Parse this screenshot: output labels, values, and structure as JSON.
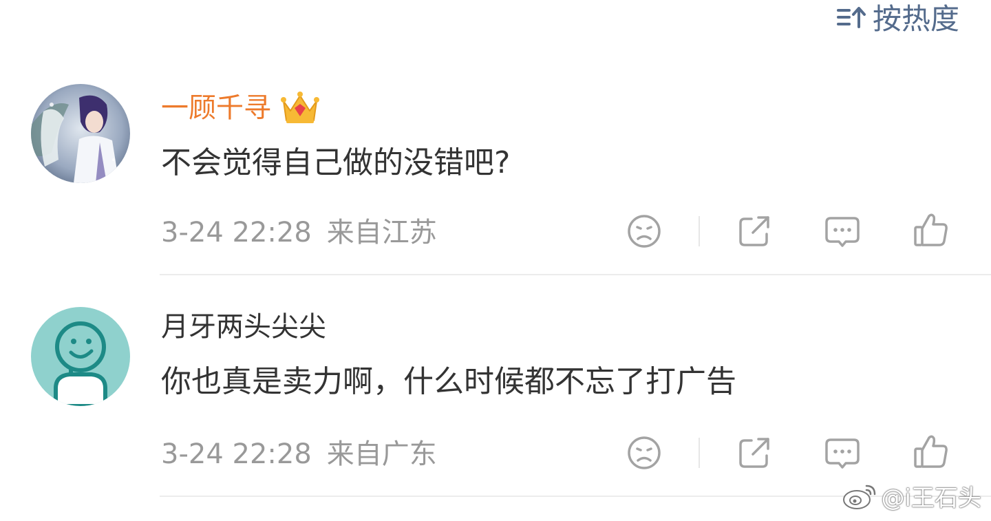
{
  "header": {
    "sort_label": "按热度"
  },
  "comments": [
    {
      "username": "一顾千寻",
      "username_color": "#ed7a2b",
      "has_vip_crown": true,
      "text": "不会觉得自己做的没错吧?",
      "time": "3-24 22:28",
      "source": "来自江苏"
    },
    {
      "username": "月牙两头尖尖",
      "username_color": "#333333",
      "has_vip_crown": false,
      "text": "你也真是卖力啊，什么时候都不忘了打广告",
      "time": "3-24 22:28",
      "source": "来自广东"
    }
  ],
  "actions": {
    "icons": [
      "dislike-icon",
      "share-icon",
      "comment-icon",
      "like-icon"
    ]
  },
  "watermark": {
    "text": "@i王石头"
  },
  "colors": {
    "accent": "#546b8c",
    "meta": "#999999",
    "icon": "#a3a3a3"
  }
}
